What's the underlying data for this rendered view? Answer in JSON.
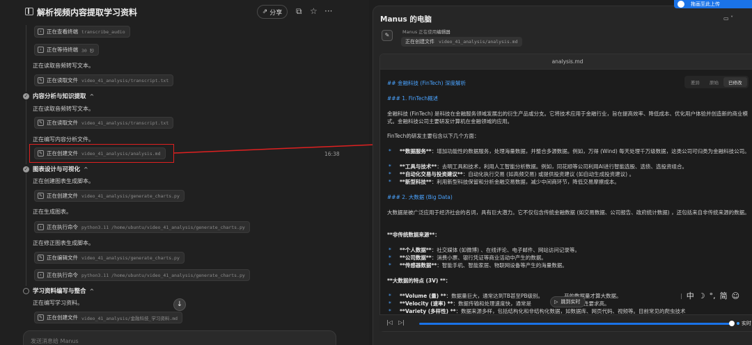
{
  "header": {
    "title": "解析视频内容提取学习资料",
    "share_label": "分享"
  },
  "feed": {
    "chip_view_terminal": {
      "action": "正在查看终端",
      "arg": "transcribe_audio"
    },
    "chip_wait_terminal": {
      "action": "正在等待终端",
      "arg": "30 秒"
    },
    "line_read_transcript_1": "正在读取音频转写文本。",
    "chip_read_transcript_1": {
      "action": "正在读取文件",
      "arg": "video_41_analysis/transcript.txt"
    },
    "section_analysis": "内容分析与知识提取",
    "line_read_transcript_2": "正在读取音频转写文本。",
    "chip_read_transcript_2": {
      "action": "正在读取文件",
      "arg": "video_41_analysis/transcript.txt"
    },
    "line_write_analysis": "正在编写内容分析文件。",
    "chip_create_analysis": {
      "action": "正在创建文件",
      "arg": "video_41_analysis/analysis.md"
    },
    "section_charts": "图表设计与可视化",
    "line_create_chart_script": "正在创建图表生成脚本。",
    "chip_create_charts": {
      "action": "正在创建文件",
      "arg": "video_41_analysis/generate_charts.py"
    },
    "line_gen_charts": "正在生成图表。",
    "chip_exec": {
      "action": "正在执行命令",
      "arg": "python3.11 /home/ubuntu/video_41_analysis/generate_charts.py"
    },
    "line_fix_script": "正在修正图表生成脚本。",
    "chip_edit_charts": {
      "action": "正在编辑文件",
      "arg": "video_41_analysis/generate_charts.py"
    },
    "chip_exec_2": {
      "action": "正在执行命令",
      "arg": "python3.11 /home/ubuntu/video_41_analysis/generate_charts.py"
    },
    "section_study": "学习资料编写与整合",
    "line_write_study": "正在编写学习资料。",
    "chip_create_study": {
      "action": "正在创建文件",
      "arg": "video_41_analysis/金融科技_学习资料.md"
    },
    "time_label": "16:38"
  },
  "input": {
    "placeholder": "发送消息给 Manus"
  },
  "right": {
    "title": "Manus 的电脑",
    "badge": "拖画至此上传",
    "using_prefix": "Manus 正在使用",
    "using_tool": "编辑器",
    "current_action": "正在创建文件",
    "current_arg": "video_41_analysis/analysis.md",
    "file_tab": "analysis.md",
    "view_tabs": [
      "差异",
      "原始",
      "已修改"
    ],
    "jump_live": "跳到实时",
    "live_label": "实时"
  },
  "markdown": {
    "h2": "## 金融科技 (FinTech) 深度解析",
    "h3_1": "### 1. FinTech概述",
    "p1": "金融科技 (FinTech) 是科技在金融服务领域发展出的衍生产品或分支。它将技术应用于金融行业，旨在提高效率、降低成本、优化用户体验并创造新的商业模式。金融科技公司主要研发计算机在金融领域的应用。",
    "p2": "FinTech的研发主要包含以下几个方面：",
    "b1_bold": "**数据服务**",
    "b1_rest": "：增加功能性的数据服务，处理海量数据，并整合多源数据。例如，万得 (Wind) 每天处理千万级数据，这类公司可归类为金融科技公司。",
    "b2_bold": "**工具与技术**",
    "b2_rest": "：去明工具和技术，利用人工智能分析数据。例如，同花顺等公司利用AI进行智能选股、选债、选投资组合。",
    "b3_bold": "**自动化交易与投资建议**",
    "b3_rest": "：自动化执行交易 (如高频交易) 或提供投资建议 (如自动生成投资建议) 。",
    "b4_bold": "**新型科技**",
    "b4_rest": "：利用新型科技保留和分析金融交易数据，减少中间商环节，降低交易摩擦成本。",
    "h3_2": "### 2. 大数据 (Big Data)",
    "p3": "大数据是被广泛应用于经济社会的名词，具有巨大潜力。它不仅包含传统金融数据 (如交易数据、公司报告、政府统计数据) ，还包括来自非传统来源的数据。",
    "p4": "**非传统数据来源**：",
    "c1_bold": "**个人数据**",
    "c1_rest": "：社交媒体 (如微博) 、在线评论、电子邮件、网站访问记录等。",
    "c2_bold": "**公司数据**",
    "c2_rest": "：消费小票、银行凭证等商业活动中产生的数据。",
    "c3_bold": "**传感器数据**",
    "c3_rest": "：智能手机、智能家居、物联网设备等产生的海量数据。",
    "p5": "**大数据的特点 (3V) **：",
    "d1_bold": "**Volume (量) **",
    "d1_rest": "：数据量巨大，通常达到TB甚至PB级别。",
    "d1_tail": "开的数据量才算大数据。",
    "d2_bold": "**Velocity (速率) **",
    "d2_rest": "：数据传输和处理速度快，通常是",
    "d2_tail": "实时性要求高。",
    "d3_bold": "**Variety (多样性) **",
    "d3_rest": "：数据来源多样，包括结构化和非结构化数据，如数据库、网页代码、视频等。目前常见的爬虫技术"
  },
  "ime": {
    "chars": [
      "中",
      "简"
    ]
  }
}
